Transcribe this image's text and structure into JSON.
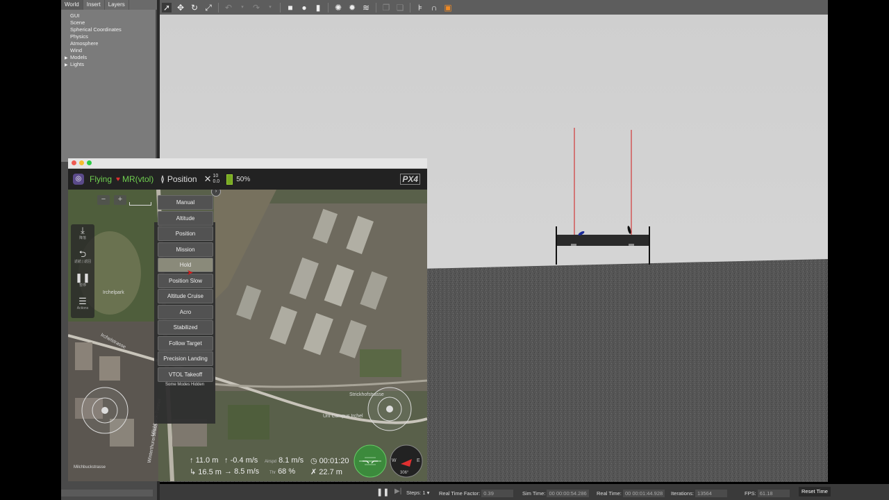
{
  "gazebo": {
    "tabs": [
      "World",
      "Insert",
      "Layers"
    ],
    "tree": [
      {
        "label": "GUI",
        "arrow": ""
      },
      {
        "label": "Scene",
        "arrow": ""
      },
      {
        "label": "Spherical Coordinates",
        "arrow": ""
      },
      {
        "label": "Physics",
        "arrow": ""
      },
      {
        "label": "Atmosphere",
        "arrow": ""
      },
      {
        "label": "Wind",
        "arrow": ""
      },
      {
        "label": "Models",
        "arrow": "▶"
      },
      {
        "label": "Lights",
        "arrow": "▶"
      }
    ],
    "status": {
      "steps_label": "Steps:",
      "steps_value": "1",
      "rtf_label": "Real Time Factor:",
      "rtf_value": "0.39",
      "sim_time_label": "Sim Time:",
      "sim_time_value": "00 00:00:54.286",
      "real_time_label": "Real Time:",
      "real_time_value": "00 00:01:44.928",
      "iterations_label": "Iterations:",
      "iterations_value": "13564",
      "fps_label": "FPS:",
      "fps_value": "61.18",
      "reset_label": "Reset Time"
    }
  },
  "qgc": {
    "flight_state": "Flying",
    "vehicle": "MR(vtol)",
    "flight_mode": "Position",
    "gps_count": "10",
    "gps_hdop": "0.0",
    "battery": "50%",
    "logo": "PX4",
    "tools": [
      {
        "label": "降落",
        "icon": "download-icon"
      },
      {
        "label": "返航 | 返回",
        "icon": "return-icon"
      },
      {
        "label": "暂停",
        "icon": "pause-icon"
      },
      {
        "label": "Actions",
        "icon": "menu-icon"
      }
    ],
    "modes": [
      "Manual",
      "Altitude",
      "Position",
      "Mission",
      "Hold",
      "Position Slow",
      "Altitude Cruise",
      "Acro",
      "Stabilized",
      "Follow Target",
      "Precision Landing",
      "VTOL Takeoff"
    ],
    "modes_highlighted": "Hold",
    "modes_footer": "Some Modes Hidden",
    "map_labels": [
      "Irchelpark",
      "Irchelstrasse",
      "Winterthurerstrasse",
      "Milchbuck-Tunnel",
      "Uni Campus Irchel",
      "Strickhofstrasse",
      "Milchbuckstrasse"
    ],
    "telemetry": {
      "alt_rel": "11.0 m",
      "vspeed": "-0.4 m/s",
      "airspeed_label": "Airspd",
      "airspeed": "8.1 m/s",
      "flight_time": "00:01:20",
      "alt_amsl": "16.5 m",
      "gspeed": "8.5 m/s",
      "throttle_label": "Thr",
      "throttle": "68 %",
      "distance": "22.7 m",
      "heading": "306°",
      "compass_w": "W",
      "compass_e": "E"
    }
  }
}
